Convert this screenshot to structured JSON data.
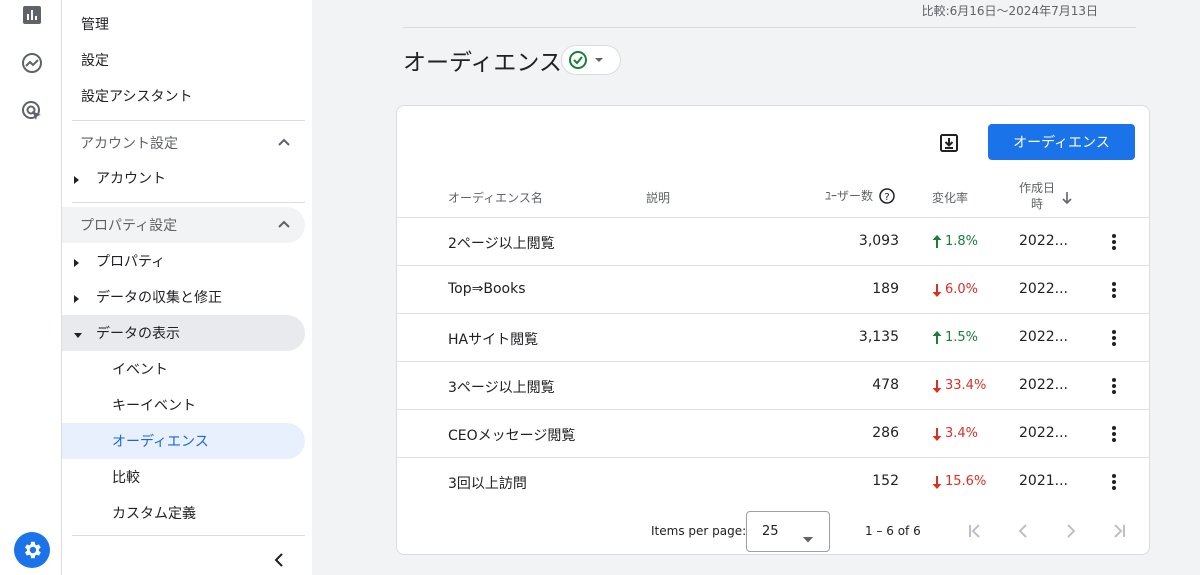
{
  "rail": {
    "icons": [
      "reports-icon",
      "explore-icon",
      "advertising-icon",
      "settings-icon"
    ]
  },
  "sidebar": {
    "items": [
      {
        "label": "管理"
      },
      {
        "label": "設定"
      },
      {
        "label": "設定アシスタント"
      }
    ],
    "account_section": {
      "label": "アカウント設定",
      "children": [
        {
          "label": "アカウント"
        }
      ]
    },
    "property_section": {
      "label": "プロパティ設定",
      "children": [
        {
          "label": "プロパティ"
        },
        {
          "label": "データの収集と修正"
        },
        {
          "label": "データの表示"
        }
      ],
      "sub_items": [
        {
          "label": "イベント"
        },
        {
          "label": "キーイベント"
        },
        {
          "label": "オーディエンス"
        },
        {
          "label": "比較"
        },
        {
          "label": "カスタム定義"
        }
      ]
    }
  },
  "header": {
    "compare_text": "比較:6月16日～2024年7月13日",
    "title": "オーディエンス"
  },
  "toolbar": {
    "create_label": "オーディエンス"
  },
  "table": {
    "headers": {
      "name": "オーディエンス名",
      "description": "説明",
      "users": "ﾕｰザー数",
      "change": "変化率",
      "created_line1": "作成日",
      "created_line2": "時"
    },
    "rows": [
      {
        "name": "2ページ以上閲覧",
        "users": "3,093",
        "direction": "up",
        "change": "1.8%",
        "created": "2022..."
      },
      {
        "name": "Top⇒Books",
        "users": "189",
        "direction": "down",
        "change": "6.0%",
        "created": "2022..."
      },
      {
        "name": "HAサイト閲覧",
        "users": "3,135",
        "direction": "up",
        "change": "1.5%",
        "created": "2022..."
      },
      {
        "name": "3ページ以上閲覧",
        "users": "478",
        "direction": "down",
        "change": "33.4%",
        "created": "2022..."
      },
      {
        "name": "CEOメッセージ閲覧",
        "users": "286",
        "direction": "down",
        "change": "3.4%",
        "created": "2022..."
      },
      {
        "name": "3回以上訪問",
        "users": "152",
        "direction": "down",
        "change": "15.6%",
        "created": "2021..."
      }
    ]
  },
  "pager": {
    "items_per_page_label": "Items per page:",
    "page_size": "25",
    "range": "1 – 6 of 6"
  },
  "colors": {
    "accent": "#1a73e8",
    "up": "#188038",
    "down": "#d93025"
  }
}
